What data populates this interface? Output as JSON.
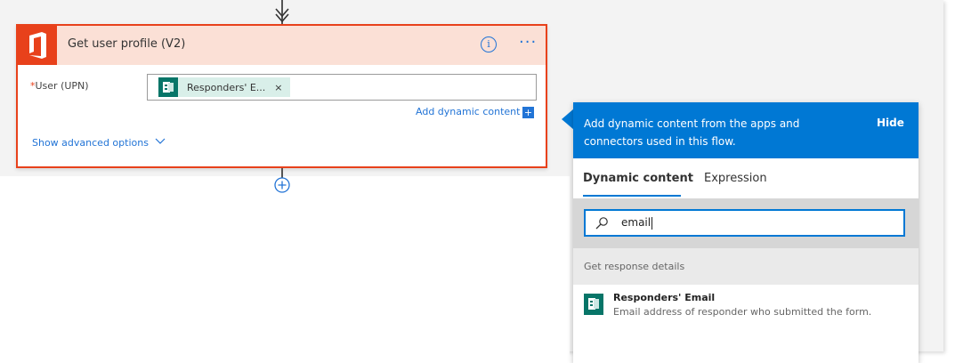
{
  "action_card": {
    "title": "Get user profile (V2)",
    "info_icon": "info-icon",
    "more_icon": "more-options-icon",
    "user_field": {
      "required_marker": "*",
      "label": "User (UPN)",
      "token_label": "Responders' E...",
      "token_remove": "×"
    },
    "add_dynamic_content": "Add dynamic content",
    "show_advanced_options": "Show advanced options",
    "accent_color": "#e8411b",
    "header_color": "#fbe0d6"
  },
  "dynamic_panel": {
    "header_text": "Add dynamic content from the apps and connectors used in this flow.",
    "hide_label": "Hide",
    "tabs": [
      {
        "label": "Dynamic content",
        "active": true
      },
      {
        "label": "Expression",
        "active": false
      }
    ],
    "search": {
      "value": "email"
    },
    "section_label": "Get response details",
    "results": [
      {
        "title": "Responders' Email",
        "description": "Email address of responder who submitted the form."
      }
    ],
    "accent_color": "#0078d4"
  },
  "icons": {
    "forms": "forms-icon",
    "office": "office-logo-icon",
    "add_step": "add-step-icon",
    "arrow_down": "arrow-down-icon",
    "search": "search-icon",
    "chevron": "chevron-down-icon"
  }
}
